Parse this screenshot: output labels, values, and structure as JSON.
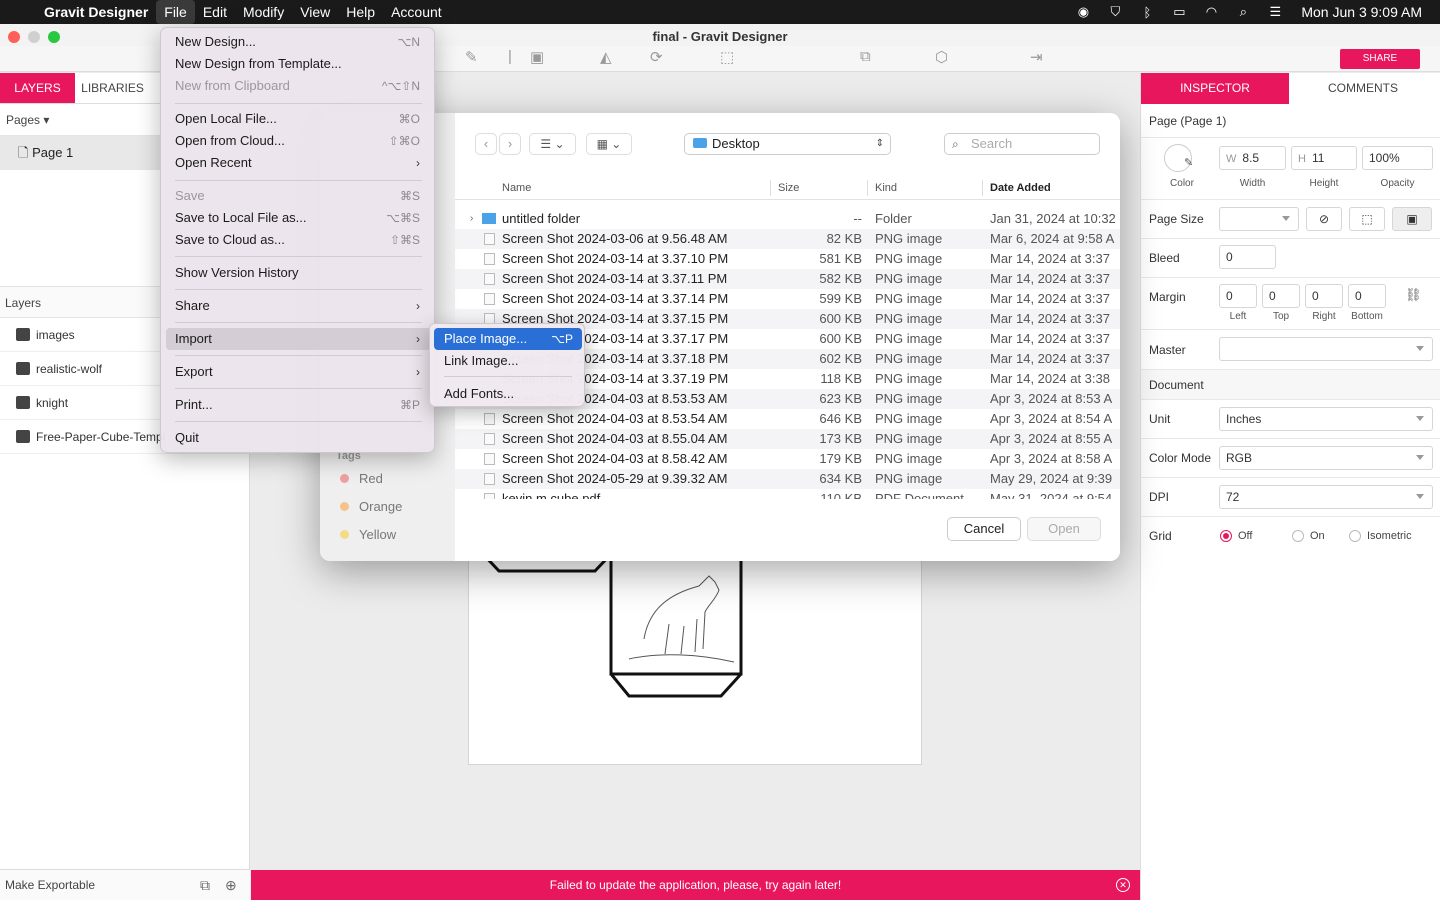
{
  "menubar": {
    "app_name": "Gravit Designer",
    "items": [
      "File",
      "Edit",
      "Modify",
      "View",
      "Help",
      "Account"
    ],
    "clock": "Mon Jun 3  9:09 AM"
  },
  "window": {
    "title": "final - Gravit Designer"
  },
  "toolbar": {
    "share_label": "SHARE"
  },
  "left_panel": {
    "tabs": [
      "LAYERS",
      "LIBRARIES"
    ],
    "pages_label": "Pages",
    "page_item": "Page 1",
    "layers_label": "Layers",
    "layers": [
      "images",
      "realistic-wolf",
      "knight",
      "Free-Paper-Cube-Templ"
    ],
    "bottom_label": "Make Exportable"
  },
  "file_menu": {
    "items": [
      {
        "label": "New Design...",
        "shortcut": "⌥N"
      },
      {
        "label": "New Design from Template...",
        "shortcut": ""
      },
      {
        "label": "New from Clipboard",
        "shortcut": "^⌥⇧N"
      },
      {
        "label": "Open Local File...",
        "shortcut": "⌘O"
      },
      {
        "label": "Open from Cloud...",
        "shortcut": "⇧⌘O"
      },
      {
        "label": "Open Recent",
        "shortcut": ""
      },
      {
        "label": "Save",
        "shortcut": "⌘S"
      },
      {
        "label": "Save to Local File as...",
        "shortcut": "⌥⌘S"
      },
      {
        "label": "Save to Cloud as...",
        "shortcut": "⇧⌘S"
      },
      {
        "label": "Show Version History",
        "shortcut": ""
      },
      {
        "label": "Share",
        "shortcut": ""
      },
      {
        "label": "Import",
        "shortcut": ""
      },
      {
        "label": "Export",
        "shortcut": ""
      },
      {
        "label": "Print...",
        "shortcut": "⌘P"
      },
      {
        "label": "Quit",
        "shortcut": ""
      }
    ]
  },
  "import_submenu": {
    "items": [
      {
        "label": "Place Image...",
        "shortcut": "⌥P"
      },
      {
        "label": "Link Image...",
        "shortcut": ""
      },
      {
        "label": "Add Fonts...",
        "shortcut": ""
      }
    ]
  },
  "dialog": {
    "location": "Desktop",
    "search_placeholder": "Search",
    "columns": {
      "name": "Name",
      "size": "Size",
      "kind": "Kind",
      "date": "Date Added"
    },
    "files": [
      {
        "name": "untitled folder",
        "size": "--",
        "kind": "Folder",
        "date": "Jan 31, 2024 at 10:32"
      },
      {
        "name": "Screen Shot 2024-03-06 at 9.56.48 AM",
        "size": "82 KB",
        "kind": "PNG image",
        "date": "Mar 6, 2024 at 9:58 A"
      },
      {
        "name": "Screen Shot 2024-03-14 at 3.37.10 PM",
        "size": "581 KB",
        "kind": "PNG image",
        "date": "Mar 14, 2024 at 3:37"
      },
      {
        "name": "Screen Shot 2024-03-14 at 3.37.11 PM",
        "size": "582 KB",
        "kind": "PNG image",
        "date": "Mar 14, 2024 at 3:37"
      },
      {
        "name": "Screen Shot 2024-03-14 at 3.37.14 PM",
        "size": "599 KB",
        "kind": "PNG image",
        "date": "Mar 14, 2024 at 3:37"
      },
      {
        "name": "Screen Shot 2024-03-14 at 3.37.15 PM",
        "size": "600 KB",
        "kind": "PNG image",
        "date": "Mar 14, 2024 at 3:37"
      },
      {
        "name": "Screen Shot 2024-03-14 at 3.37.17 PM",
        "size": "600 KB",
        "kind": "PNG image",
        "date": "Mar 14, 2024 at 3:37"
      },
      {
        "name": "Screen Shot 2024-03-14 at 3.37.18 PM",
        "size": "602 KB",
        "kind": "PNG image",
        "date": "Mar 14, 2024 at 3:37"
      },
      {
        "name": "Screen Shot 2024-03-14 at 3.37.19 PM",
        "size": "118 KB",
        "kind": "PNG image",
        "date": "Mar 14, 2024 at 3:38"
      },
      {
        "name": "Screen Shot 2024-04-03 at 8.53.53 AM",
        "size": "623 KB",
        "kind": "PNG image",
        "date": "Apr 3, 2024 at 8:53 A"
      },
      {
        "name": "Screen Shot 2024-04-03 at 8.53.54 AM",
        "size": "646 KB",
        "kind": "PNG image",
        "date": "Apr 3, 2024 at 8:54 A"
      },
      {
        "name": "Screen Shot 2024-04-03 at 8.55.04 AM",
        "size": "173 KB",
        "kind": "PNG image",
        "date": "Apr 3, 2024 at 8:55 A"
      },
      {
        "name": "Screen Shot 2024-04-03 at 8.58.42 AM",
        "size": "179 KB",
        "kind": "PNG image",
        "date": "Apr 3, 2024 at 8:58 A"
      },
      {
        "name": "Screen Shot 2024-05-29 at 9.39.32 AM",
        "size": "634 KB",
        "kind": "PNG image",
        "date": "May 29, 2024 at 9:39"
      },
      {
        "name": "kevin m cube.pdf",
        "size": "110 KB",
        "kind": "PDF Document",
        "date": "May 31, 2024 at 9:54"
      }
    ],
    "tags_label": "Tags",
    "tags": [
      {
        "label": "Red",
        "color": "#f0a0a0"
      },
      {
        "label": "Orange",
        "color": "#f5c28a"
      },
      {
        "label": "Yellow",
        "color": "#f3dc86"
      }
    ],
    "cancel_label": "Cancel",
    "open_label": "Open"
  },
  "inspector": {
    "tabs": [
      "INSPECTOR",
      "COMMENTS"
    ],
    "page_title": "Page (Page 1)",
    "color_label": "Color",
    "width_prefix": "W",
    "width_value": "8.5",
    "width_label": "Width",
    "height_prefix": "H",
    "height_value": "11",
    "height_label": "Height",
    "opacity_value": "100%",
    "opacity_label": "Opacity",
    "page_size_label": "Page Size",
    "bleed_label": "Bleed",
    "bleed_value": "0",
    "margin_label": "Margin",
    "margins": [
      {
        "value": "0",
        "label": "Left"
      },
      {
        "value": "0",
        "label": "Top"
      },
      {
        "value": "0",
        "label": "Right"
      },
      {
        "value": "0",
        "label": "Bottom"
      }
    ],
    "master_label": "Master",
    "document_label": "Document",
    "unit_label": "Unit",
    "unit_value": "Inches",
    "color_mode_label": "Color Mode",
    "color_mode_value": "RGB",
    "dpi_label": "DPI",
    "dpi_value": "72",
    "grid_label": "Grid",
    "grid_options": [
      "Off",
      "On",
      "Isometric"
    ],
    "grid_selected": "Off"
  },
  "error_bar": {
    "message": "Failed to update the application, please, try again later!"
  },
  "colors": {
    "accent": "#e8175d",
    "selection": "#2a6fd6"
  }
}
